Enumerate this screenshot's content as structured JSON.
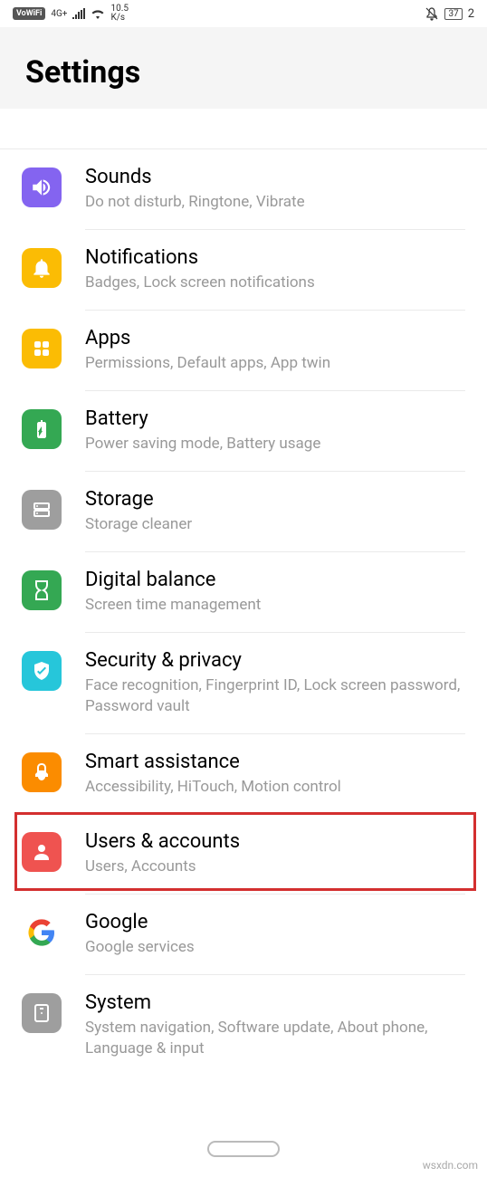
{
  "statusBar": {
    "vowifi": "VoWiFi",
    "network": "4G+",
    "speed1": "10.5",
    "speed2": "K/s",
    "battery": "37",
    "batterySuffix": "2"
  },
  "header": {
    "title": "Settings"
  },
  "items": [
    {
      "title": "Sounds",
      "subtitle": "Do not disturb, Ringtone, Vibrate"
    },
    {
      "title": "Notifications",
      "subtitle": "Badges, Lock screen notifications"
    },
    {
      "title": "Apps",
      "subtitle": "Permissions, Default apps, App twin"
    },
    {
      "title": "Battery",
      "subtitle": "Power saving mode, Battery usage"
    },
    {
      "title": "Storage",
      "subtitle": "Storage cleaner"
    },
    {
      "title": "Digital balance",
      "subtitle": "Screen time management"
    },
    {
      "title": "Security & privacy",
      "subtitle": "Face recognition, Fingerprint ID, Lock screen password, Password vault"
    },
    {
      "title": "Smart assistance",
      "subtitle": "Accessibility, HiTouch, Motion control"
    },
    {
      "title": "Users & accounts",
      "subtitle": "Users, Accounts"
    },
    {
      "title": "Google",
      "subtitle": "Google services"
    },
    {
      "title": "System",
      "subtitle": "System navigation, Software update, About phone, Language & input"
    }
  ],
  "watermark": "wsxdn.com"
}
